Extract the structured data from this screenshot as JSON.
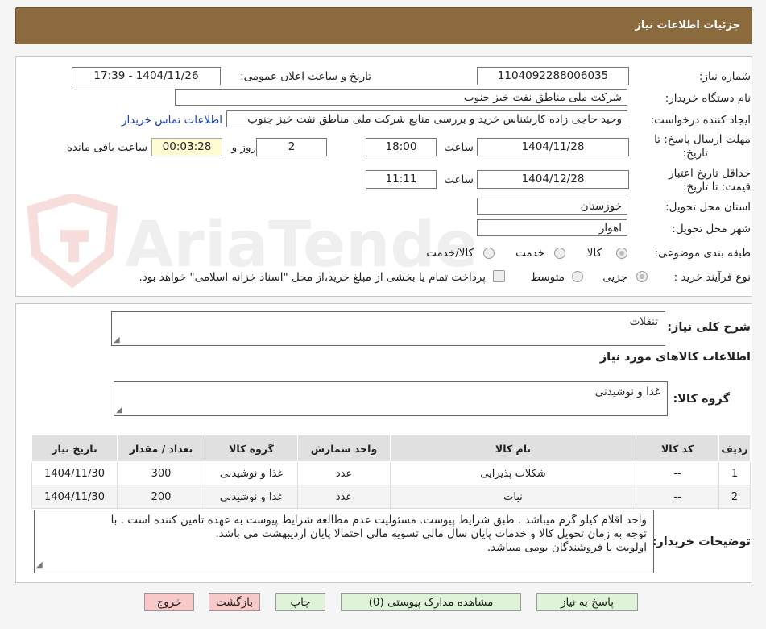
{
  "header": {
    "title": "جزئیات اطلاعات نیاز"
  },
  "watermark": {
    "text": "AriaTender.neT"
  },
  "form": {
    "need_number_label": "شماره نیاز:",
    "need_number": "1104092288006035",
    "announce_label": "تاریخ و ساعت اعلان عمومی:",
    "announce_value": "1404/11/26 - 17:39",
    "buyer_org_label": "نام دستگاه خریدار:",
    "buyer_org": "شرکت ملی مناطق نفت خیز جنوب",
    "creator_label": "ایجاد کننده درخواست:",
    "creator": "وحید حاجی زاده  کارشناس خرید و بررسی منابع  شرکت ملی مناطق نفت خیز جنوب",
    "contact_link": "اطلاعات تماس خریدار",
    "deadline_label_1": "مهلت ارسال پاسخ: تا",
    "deadline_label_2": "تاریخ:",
    "deadline_date": "1404/11/28",
    "time_word": "ساعت",
    "deadline_time": "18:00",
    "days_value": "2",
    "days_word": "روز و",
    "remaining_time": "00:03:28",
    "remaining_word": "ساعت باقی مانده",
    "validity_label_1": "حداقل تاریخ اعتبار",
    "validity_label_2": "قیمت: تا تاریخ:",
    "validity_date": "1404/12/28",
    "validity_time": "11:11",
    "province_label": "استان محل تحویل:",
    "province": "خوزستان",
    "city_label": "شهر محل تحویل:",
    "city": "اهواز",
    "category_label": "طبقه بندی موضوعی:",
    "category_options": [
      "کالا",
      "خدمت",
      "کالا/خدمت"
    ],
    "process_label": "نوع فرآیند خرید :",
    "process_options": [
      "جزیی",
      "متوسط"
    ],
    "payment_note": "پرداخت تمام یا بخشی از مبلغ خرید،از محل \"اسناد خزانه اسلامی\" خواهد بود."
  },
  "need": {
    "summary_label": "شرح کلی نیاز:",
    "summary": "تنقلات",
    "goods_info_title": "اطلاعات کالاهای مورد نیاز",
    "group_label": "گروه کالا:",
    "group": "غذا و نوشیدنی"
  },
  "table": {
    "headers": [
      "ردیف",
      "کد کالا",
      "نام کالا",
      "واحد شمارش",
      "گروه کالا",
      "تعداد / مقدار",
      "تاریخ نیاز"
    ],
    "rows": [
      [
        "1",
        "--",
        "شکلات پذیرایی",
        "عدد",
        "غذا و نوشیدنی",
        "300",
        "1404/11/30"
      ],
      [
        "2",
        "--",
        "نبات",
        "عدد",
        "غذا و نوشیدنی",
        "200",
        "1404/11/30"
      ]
    ]
  },
  "buyer_notes": {
    "label": "توضیحات خریدار:",
    "lines": [
      "واحد اقلام کیلو گرم میباشد . طبق شرایط پیوست. مسئولیت عدم مطالعه شرایط پیوست به عهده تامین کننده است . با",
      "توجه به زمان تحویل کالا و خدمات پایان سال مالی  تسویه مالی احتمالا پایان اردیبهشت می باشد.",
      "اولویت با فروشندگان بومی میباشد."
    ]
  },
  "buttons": {
    "reply": "پاسخ به نیاز",
    "attachments": "مشاهده مدارک پیوستی (0)",
    "print": "چاپ",
    "back": "بازگشت",
    "exit": "خروج"
  }
}
